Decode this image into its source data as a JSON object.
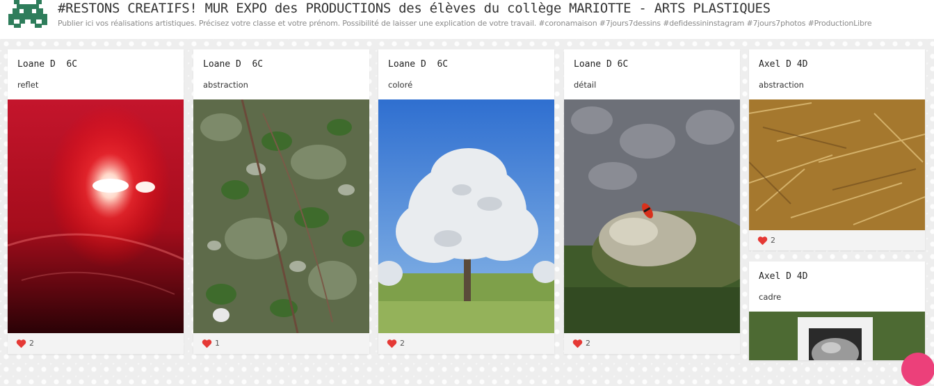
{
  "header": {
    "title": "#RESTONS CREATIFS! MUR EXPO des PRODUCTIONS des élèves du collège MARIOTTE - ARTS PLASTIQUES",
    "subtitle": "Publier ici vos réalisations artistiques. Précisez votre classe et votre prénom. Possibilité de laisser une explication de votre travail. #coronamaison #7jours7dessins #defidessininstagram #7jours7photos #ProductionLibre",
    "logo_icon": "space-invader-icon"
  },
  "posts": [
    {
      "author": "Loane D  6C",
      "description": "reflet",
      "likes": "2",
      "image": "red-reflection-photo"
    },
    {
      "author": "Loane D  6C",
      "description": "abstraction",
      "likes": "1",
      "image": "ivy-leaves-photo"
    },
    {
      "author": "Loane D  6C",
      "description": "coloré",
      "likes": "2",
      "image": "blossom-tree-photo"
    },
    {
      "author": "Loane D 6C",
      "description": "détail",
      "likes": "2",
      "image": "firebug-on-stone-photo"
    },
    {
      "author": "Axel D 4D",
      "description": "abstraction",
      "likes": "2",
      "image": "straw-photo"
    },
    {
      "author": "Axel D 4D",
      "description": "cadre",
      "likes": "",
      "image": "frame-photo"
    }
  ],
  "colors": {
    "heart": "#e53935",
    "fab": "#ec407a",
    "logo": "#2e7d5b"
  }
}
